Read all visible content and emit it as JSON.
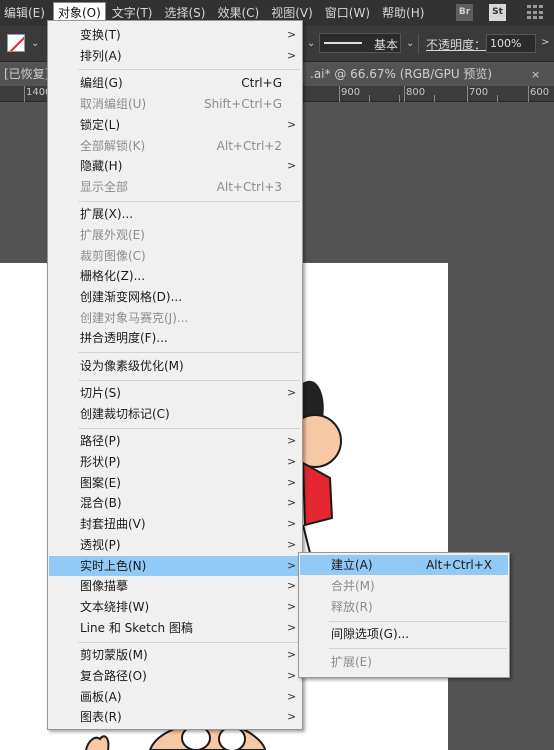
{
  "menubar": {
    "items": [
      "编辑(E)",
      "对象(O)",
      "文字(T)",
      "选择(S)",
      "效果(C)",
      "视图(V)",
      "窗口(W)",
      "帮助(H)"
    ],
    "app_icons": [
      "Br",
      "St"
    ],
    "grid_icon": "workspace-grid-icon"
  },
  "controlbar": {
    "stroke_style": "基本",
    "opacity_label": "不透明度：",
    "opacity_value": "100%"
  },
  "tab": {
    "title_left": "[已恢复]",
    "title_right": ".ai* @ 66.67% (RGB/GPU 预览)",
    "close": "×"
  },
  "ruler": {
    "labels": [
      "1400",
      "900",
      "800",
      "700",
      "600"
    ]
  },
  "object_menu": {
    "items": [
      {
        "label": "变换(T)",
        "shortcut": "",
        "submenu": true,
        "disabled": false
      },
      {
        "label": "排列(A)",
        "shortcut": "",
        "submenu": true,
        "disabled": false
      },
      {
        "label": "编组(G)",
        "shortcut": "Ctrl+G",
        "submenu": false,
        "disabled": false
      },
      {
        "label": "取消编组(U)",
        "shortcut": "Shift+Ctrl+G",
        "submenu": false,
        "disabled": true
      },
      {
        "label": "锁定(L)",
        "shortcut": "",
        "submenu": true,
        "disabled": false
      },
      {
        "label": "全部解锁(K)",
        "shortcut": "Alt+Ctrl+2",
        "submenu": false,
        "disabled": true
      },
      {
        "label": "隐藏(H)",
        "shortcut": "",
        "submenu": true,
        "disabled": false
      },
      {
        "label": "显示全部",
        "shortcut": "Alt+Ctrl+3",
        "submenu": false,
        "disabled": true
      },
      {
        "label": "扩展(X)...",
        "shortcut": "",
        "submenu": false,
        "disabled": false
      },
      {
        "label": "扩展外观(E)",
        "shortcut": "",
        "submenu": false,
        "disabled": true
      },
      {
        "label": "裁剪图像(C)",
        "shortcut": "",
        "submenu": false,
        "disabled": true
      },
      {
        "label": "栅格化(Z)...",
        "shortcut": "",
        "submenu": false,
        "disabled": false
      },
      {
        "label": "创建渐变网格(D)...",
        "shortcut": "",
        "submenu": false,
        "disabled": false
      },
      {
        "label": "创建对象马赛克(J)...",
        "shortcut": "",
        "submenu": false,
        "disabled": true
      },
      {
        "label": "拼合透明度(F)...",
        "shortcut": "",
        "submenu": false,
        "disabled": false
      },
      {
        "label": "设为像素级优化(M)",
        "shortcut": "",
        "submenu": false,
        "disabled": false
      },
      {
        "label": "切片(S)",
        "shortcut": "",
        "submenu": true,
        "disabled": false
      },
      {
        "label": "创建裁切标记(C)",
        "shortcut": "",
        "submenu": false,
        "disabled": false
      },
      {
        "label": "路径(P)",
        "shortcut": "",
        "submenu": true,
        "disabled": false
      },
      {
        "label": "形状(P)",
        "shortcut": "",
        "submenu": true,
        "disabled": false
      },
      {
        "label": "图案(E)",
        "shortcut": "",
        "submenu": true,
        "disabled": false
      },
      {
        "label": "混合(B)",
        "shortcut": "",
        "submenu": true,
        "disabled": false
      },
      {
        "label": "封套扭曲(V)",
        "shortcut": "",
        "submenu": true,
        "disabled": false
      },
      {
        "label": "透视(P)",
        "shortcut": "",
        "submenu": true,
        "disabled": false
      },
      {
        "label": "实时上色(N)",
        "shortcut": "",
        "submenu": true,
        "disabled": false,
        "highlighted": true
      },
      {
        "label": "图像描摹",
        "shortcut": "",
        "submenu": true,
        "disabled": false
      },
      {
        "label": "文本绕排(W)",
        "shortcut": "",
        "submenu": true,
        "disabled": false
      },
      {
        "label": "Line 和 Sketch 图稿",
        "shortcut": "",
        "submenu": true,
        "disabled": false
      },
      {
        "label": "剪切蒙版(M)",
        "shortcut": "",
        "submenu": true,
        "disabled": false
      },
      {
        "label": "复合路径(O)",
        "shortcut": "",
        "submenu": true,
        "disabled": false
      },
      {
        "label": "画板(A)",
        "shortcut": "",
        "submenu": true,
        "disabled": false
      },
      {
        "label": "图表(R)",
        "shortcut": "",
        "submenu": true,
        "disabled": false
      }
    ]
  },
  "live_paint_submenu": {
    "items": [
      {
        "label": "建立(A)",
        "shortcut": "Alt+Ctrl+X",
        "disabled": false,
        "highlighted": true
      },
      {
        "label": "合并(M)",
        "shortcut": "",
        "disabled": true
      },
      {
        "label": "释放(R)",
        "shortcut": "",
        "disabled": true
      },
      {
        "label": "间隙选项(G)...",
        "shortcut": "",
        "disabled": false
      },
      {
        "label": "扩展(E)",
        "shortcut": "",
        "disabled": true
      }
    ]
  },
  "colors": {
    "menu_bg": "#f0f0f0",
    "highlight": "#91c9f7",
    "disabled_text": "#8d8d8d",
    "app_bg": "#535353"
  }
}
